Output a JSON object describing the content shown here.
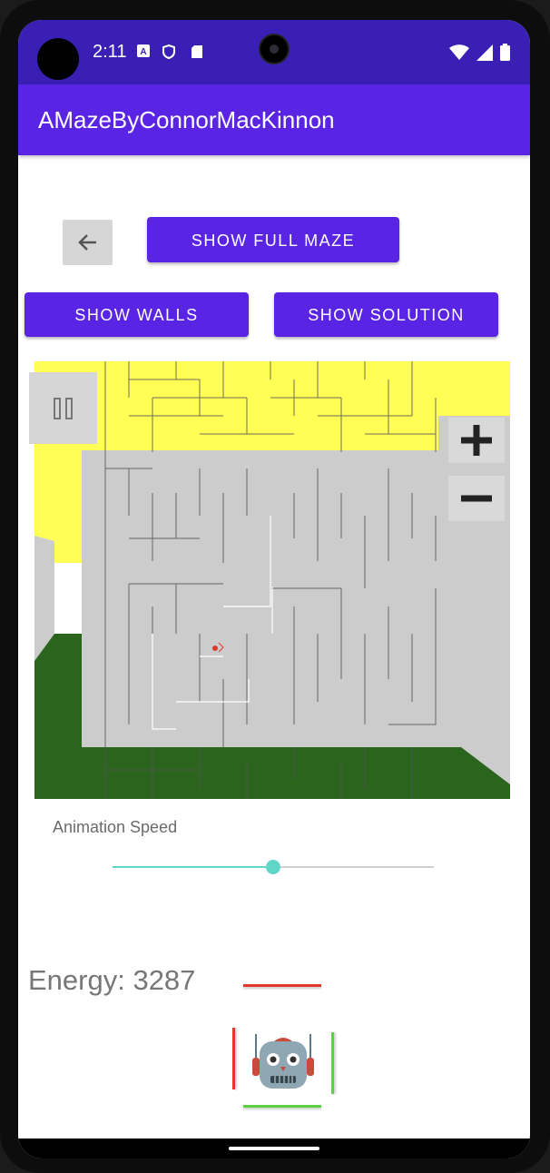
{
  "status_bar": {
    "time": "2:11",
    "icons": [
      "translate-icon",
      "shield-icon",
      "sd-card-icon"
    ],
    "right_icons": [
      "wifi-icon",
      "signal-icon",
      "battery-icon"
    ]
  },
  "app_bar": {
    "title": "AMazeByConnorMacKinnon"
  },
  "controls": {
    "back_icon": "arrow-back-icon",
    "show_full_maze": "SHOW FULL MAZE",
    "show_walls": "SHOW WALLS",
    "show_solution": "SHOW SOLUTION",
    "pause_icon": "pause-icon",
    "zoom_in_icon": "plus-icon",
    "zoom_out_icon": "minus-icon"
  },
  "colors": {
    "accent": "#5a24e4",
    "status_bar": "#3a1fb4",
    "maze_yellow": "#ffff55",
    "maze_gray": "#cccccc",
    "maze_green": "#2b641c",
    "slider": "#5fd6c8",
    "sensor_red": "#e0392b",
    "sensor_green": "#5ccf45"
  },
  "animation": {
    "label": "Animation Speed",
    "value": 0.5
  },
  "robot": {
    "energy_text": "Energy: 3287",
    "icon": "robot-icon",
    "sensors": {
      "forward": "red",
      "left": "red",
      "right": "green",
      "backward": "green"
    }
  }
}
